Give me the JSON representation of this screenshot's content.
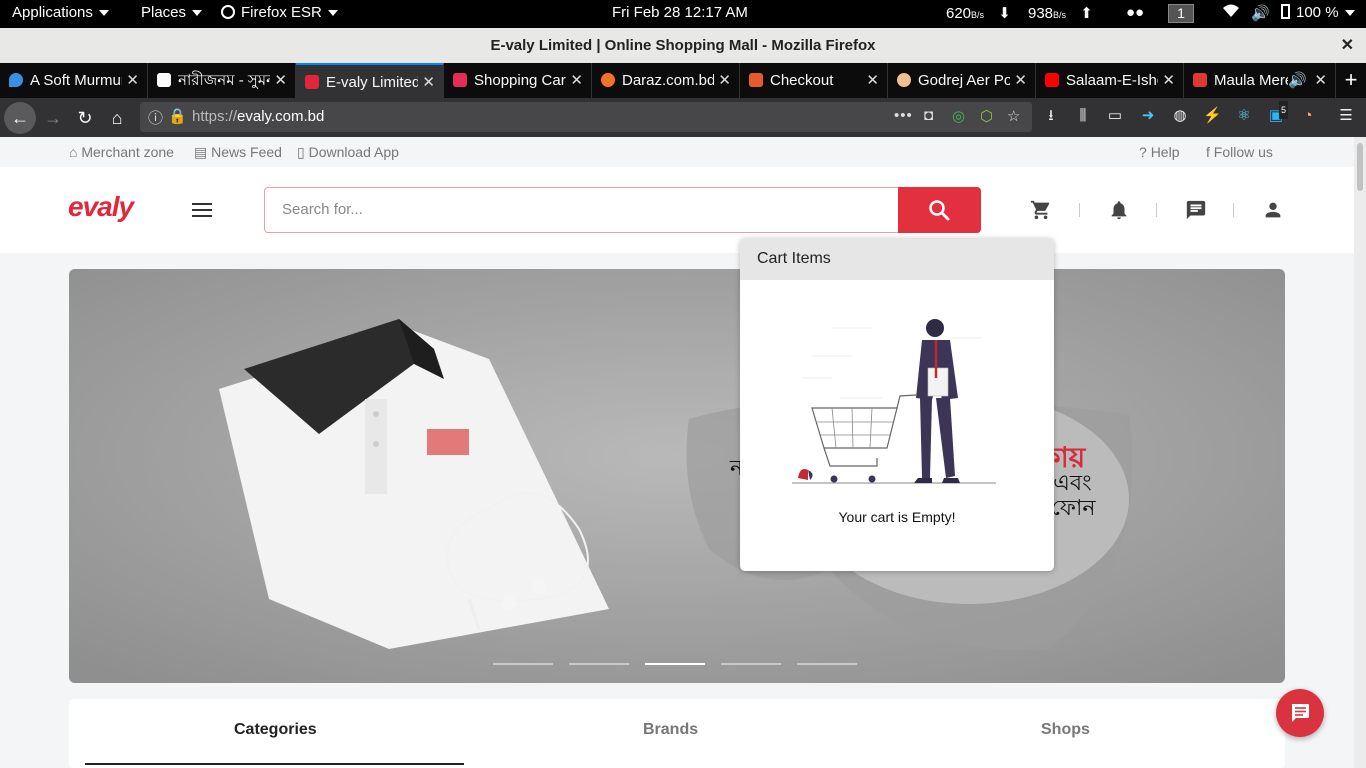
{
  "system_bar": {
    "applications": "Applications",
    "places": "Places",
    "firefox": "Firefox ESR",
    "datetime": "Fri Feb 28  12:17 AM",
    "net_down": "620",
    "net_down_unit": "B/s",
    "net_up": "938",
    "net_up_unit": "B/s",
    "workspace": "1",
    "battery": "100 %"
  },
  "window": {
    "title": "E-valy Limited | Online Shopping Mall - Mozilla Firefox"
  },
  "tabs": [
    {
      "label": "A Soft Murmur",
      "favicon_color": "#3a8ee6"
    },
    {
      "label": "নারীজনম - সুমন দ",
      "favicon_color": "#ffffff"
    },
    {
      "label": "E-valy Limited",
      "favicon_color": "#e4263a"
    },
    {
      "label": "Shopping Cart",
      "favicon_color": "#e22d5a"
    },
    {
      "label": "Daraz.com.bd",
      "favicon_color": "#f57224"
    },
    {
      "label": "Checkout",
      "favicon_color": "#e65b2a"
    },
    {
      "label": "Godrej Aer Pocket",
      "favicon_color": "#f0c090"
    },
    {
      "label": "Salaam-E-Ishq",
      "favicon_color": "#ff0000"
    },
    {
      "label": "Maula Mere",
      "favicon_color": "#e03a2e"
    }
  ],
  "navbar": {
    "url_prefix": "https://",
    "url_domain": "evaly.com.bd",
    "badge_count": "5"
  },
  "site": {
    "top_links": {
      "merchant": "Merchant zone",
      "news": "News Feed",
      "download": "Download App",
      "help": "Help",
      "follow": "Follow us"
    },
    "logo_e": "e",
    "logo_rest": "valy",
    "search_placeholder": "Search for...",
    "banner_text": {
      "line1": "কায়",
      "line2": "র্ট এবং",
      "line3": "ফোন",
      "left_char": "ন"
    },
    "slider_active_index": 2,
    "slider_count": 5,
    "section_tabs": {
      "categories": "Categories",
      "brands": "Brands",
      "shops": "Shops"
    },
    "active_section": "Categories"
  },
  "cart_popup": {
    "title": "Cart Items",
    "empty_message": "Your cart is Empty!"
  },
  "colors": {
    "brand_red": "#e3303f",
    "tab_accent": "#0a84ff"
  }
}
